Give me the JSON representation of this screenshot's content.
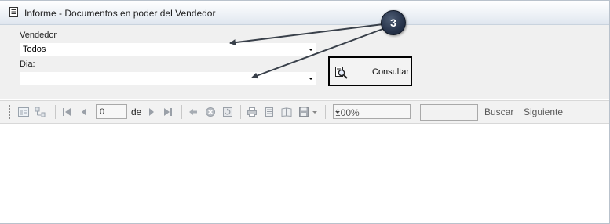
{
  "window": {
    "title": "Informe - Documentos en poder del Vendedor"
  },
  "params": {
    "vendedor_label": "Vendedor",
    "vendedor_value": "Todos",
    "dia_label": "Dia:",
    "dia_value": "",
    "consultar_label": "Consultar"
  },
  "toolbar": {
    "page_number": "0",
    "of_label": "de",
    "zoom_value": "100%",
    "search_value": "",
    "search_label": "Buscar",
    "next_label": "Siguiente"
  },
  "annotation": {
    "number": "3",
    "color": "#27334a"
  }
}
